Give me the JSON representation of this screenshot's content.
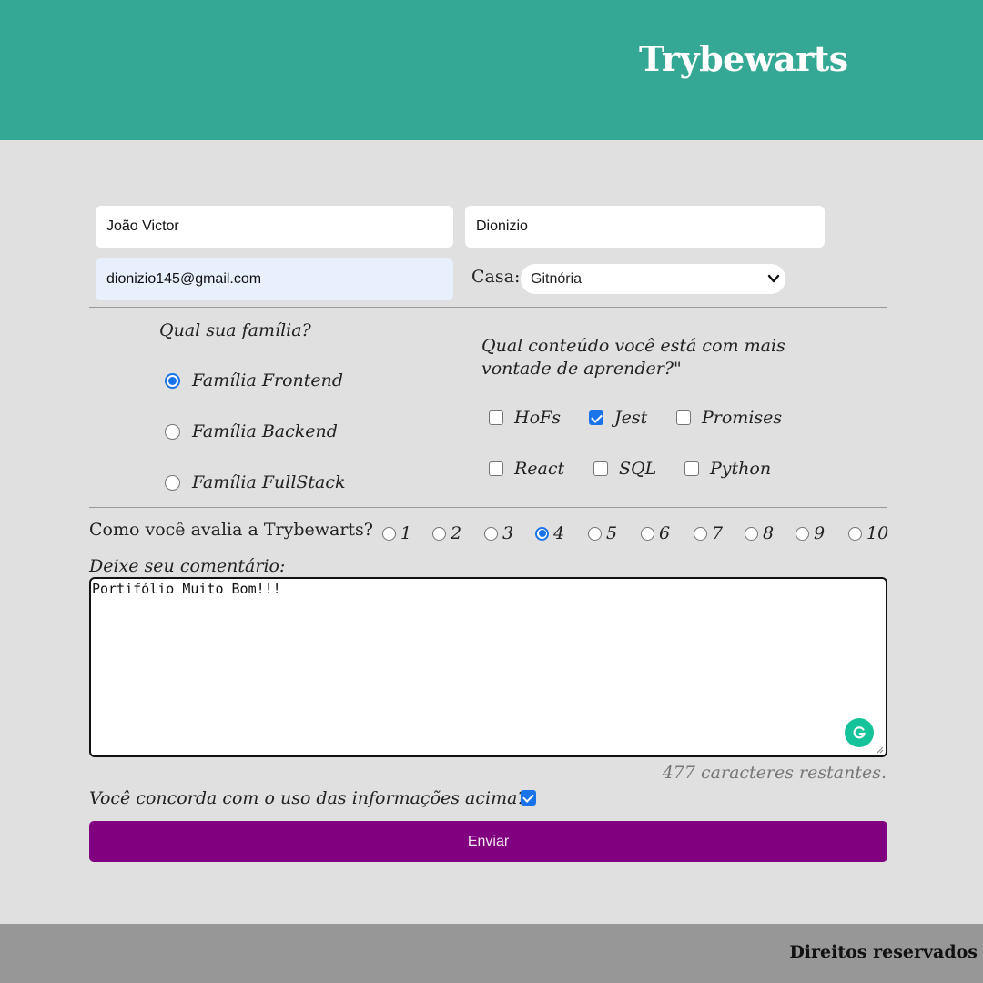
{
  "header": {
    "title": "Trybewarts"
  },
  "form": {
    "first_name": "João Victor",
    "last_name": "Dionizio",
    "email": "dionizio145@gmail.com",
    "house_label": "Casa:",
    "house_selected": "Gitnória",
    "family": {
      "title": "Qual sua família?",
      "options": [
        "Família Frontend",
        "Família Backend",
        "Família FullStack"
      ],
      "selected": "Família Frontend"
    },
    "content": {
      "title": "Qual conteúdo você está com mais vontade de aprender?\"",
      "options": [
        "HoFs",
        "Jest",
        "Promises",
        "React",
        "SQL",
        "Python"
      ],
      "checked": [
        "Jest"
      ]
    },
    "rating": {
      "label": "Como você avalia a Trybewarts?",
      "options": [
        "1",
        "2",
        "3",
        "4",
        "5",
        "6",
        "7",
        "8",
        "9",
        "10"
      ],
      "selected": "4"
    },
    "comment_label": "Deixe seu comentário:",
    "comment_value": "Portifólio Muito Bom!!!",
    "counter": "477 caracteres restantes.",
    "agreement_label": "Você concorda com o uso das informações acima?",
    "agreement_checked": true,
    "submit_label": "Enviar"
  },
  "footer": {
    "text": "Direitos reservados"
  },
  "colors": {
    "header_bg": "#34a894",
    "page_bg": "#e0e0e0",
    "submit_bg": "#800080",
    "footer_bg": "#979797",
    "accent": "#1a73e8",
    "grammarly": "#15c39a"
  },
  "icons": {
    "select": "chevron-down-icon",
    "grammarly": "grammarly-icon",
    "resize": "resize-handle-icon"
  }
}
